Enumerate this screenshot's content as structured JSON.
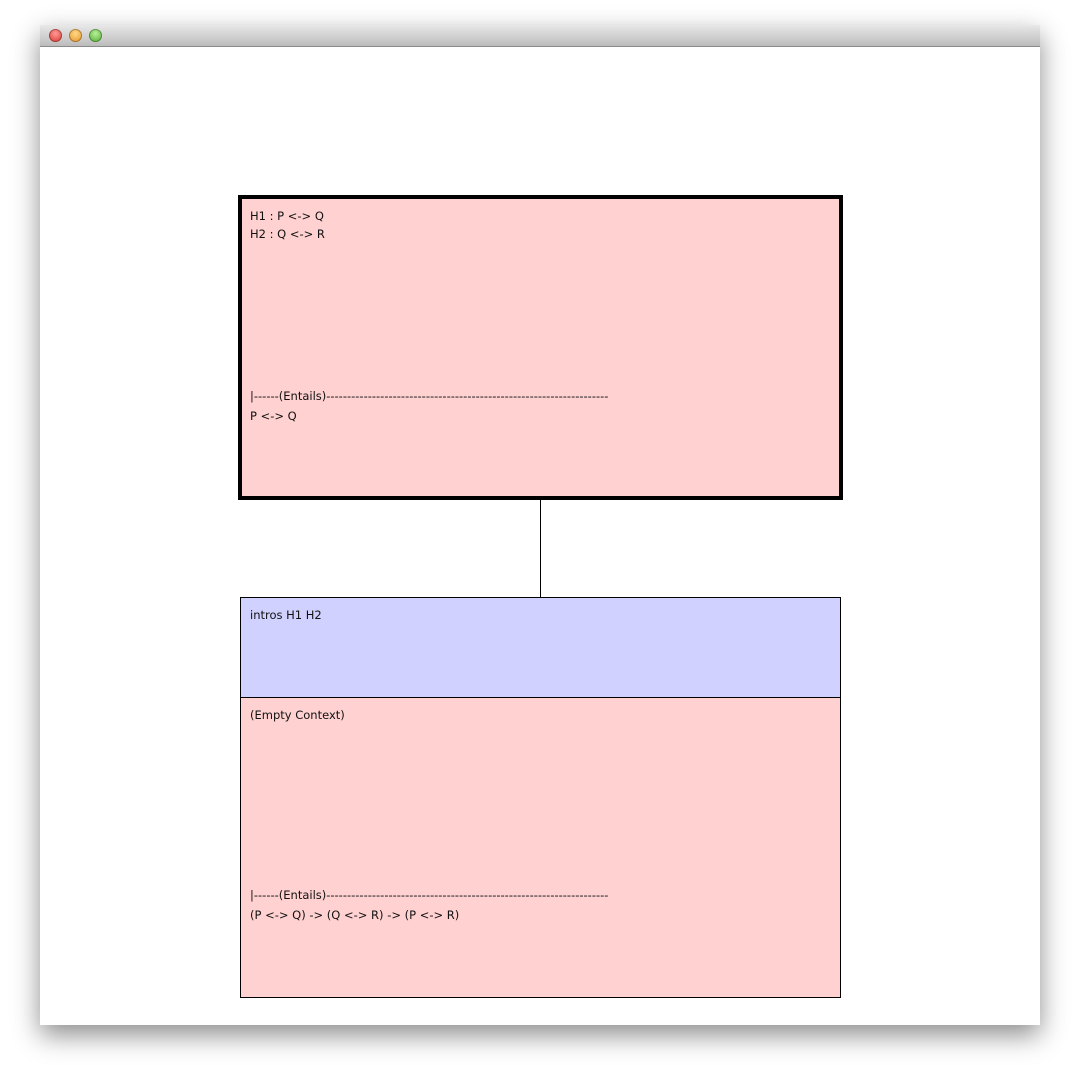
{
  "window": {
    "buttons": [
      "close",
      "minimize",
      "zoom"
    ],
    "colors": {
      "close": "#e0443e",
      "minimize": "#f0a22c",
      "zoom": "#5fbf3c"
    }
  },
  "goal_node": {
    "hypotheses": [
      "H1 : P <-> Q",
      "H2 : Q <-> R"
    ],
    "separator": "|------(Entails)--------------------------------------------------------------------",
    "goal": "P <-> Q",
    "color": "#ffd1d1",
    "selected": true
  },
  "tactic_node": {
    "tactic": "intros H1 H2",
    "color": "#d1d1ff"
  },
  "root_node": {
    "context": "(Empty Context)",
    "separator": "|------(Entails)--------------------------------------------------------------------",
    "goal": "(P <-> Q) -> (Q <-> R) -> (P <-> R)",
    "color": "#ffd1d1"
  }
}
